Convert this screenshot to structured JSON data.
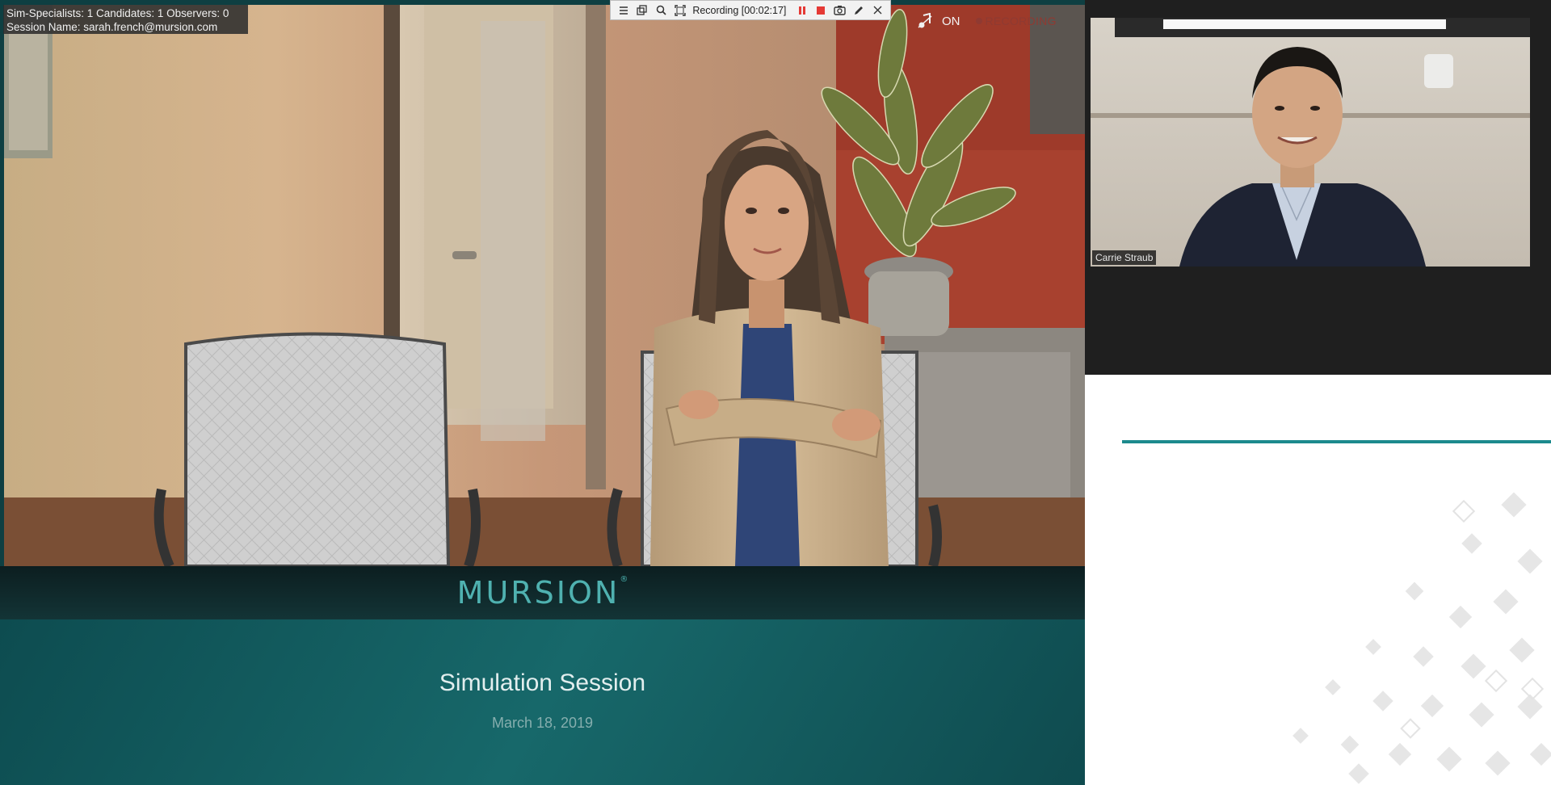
{
  "session_info": {
    "counts_line": "Sim-Specialists: 1  Candidates: 1  Observers: 0",
    "session_line": "Session Name: sarah.french@mursion.com"
  },
  "recording_toolbar": {
    "label": "Recording [00:02:17]",
    "icons": [
      "menu-icon",
      "popout-icon",
      "search-icon",
      "select-region-icon",
      "pause-icon",
      "stop-icon",
      "camera-icon",
      "pen-icon",
      "close-icon"
    ]
  },
  "status": {
    "on_label": "ON",
    "recording_label": "RECORDING"
  },
  "brand": {
    "logo": "MURSION",
    "registered": "®",
    "accent": "#4fb1b0"
  },
  "slide": {
    "title": "Simulation Session",
    "date": "March 18, 2019"
  },
  "participant": {
    "name": "Carrie Straub"
  },
  "colors": {
    "teal": "#1c8a8d",
    "record_red": "#e53935"
  }
}
